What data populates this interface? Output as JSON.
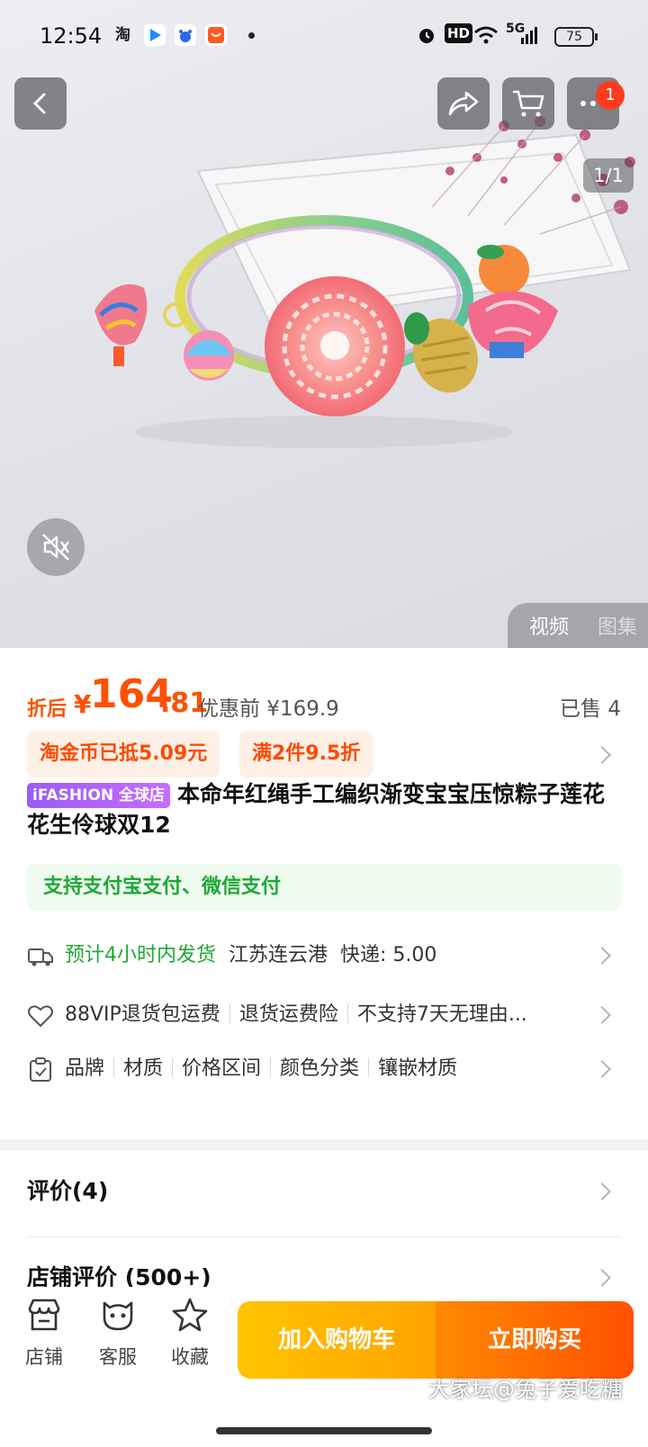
{
  "status_bar": {
    "time": "12:54",
    "hd_label": "HD",
    "network_label": "5G",
    "battery": "75"
  },
  "hero": {
    "image_description_icon": "bracelet-product-photo",
    "cart_badge": "1",
    "pager": "1/1",
    "media_tabs": [
      "视频",
      "图集"
    ]
  },
  "price": {
    "prefix": "折后",
    "currency": "¥",
    "integer": "164",
    "decimal": ".81",
    "original": "优惠前 ¥169.9",
    "sold": "已售 4"
  },
  "promos": [
    "淘金币已抵5.09元",
    "满2件9.5折"
  ],
  "product": {
    "brand_tag": "iFASHION 全球店",
    "title": "本命年红绳手工编织渐变宝宝压惊粽子莲花花生伶球双12"
  },
  "payment_note": "支持支付宝支付、微信支付",
  "shipping": {
    "estimate": "预计4小时内发货",
    "origin": "江苏连云港",
    "fee": "快递: 5.00"
  },
  "service": [
    "88VIP退货包运费",
    "退货运费险",
    "不支持7天无理由..."
  ],
  "params": [
    "品牌",
    "材质",
    "价格区间",
    "颜色分类",
    "镶嵌材质"
  ],
  "reviews": {
    "item_reviews": "评价(4)",
    "shop_reviews": "店铺评价 (500+)"
  },
  "bottom_bar": {
    "tabs": [
      "店铺",
      "客服",
      "收藏"
    ],
    "add_to_cart": "加入购物车",
    "buy_now": "立即购买",
    "watermark": "大家坛@兔子爱吃糖"
  },
  "colors": {
    "price_orange": "#ff5000",
    "green": "#1ea835",
    "cart_yellow": "#ffb300"
  }
}
